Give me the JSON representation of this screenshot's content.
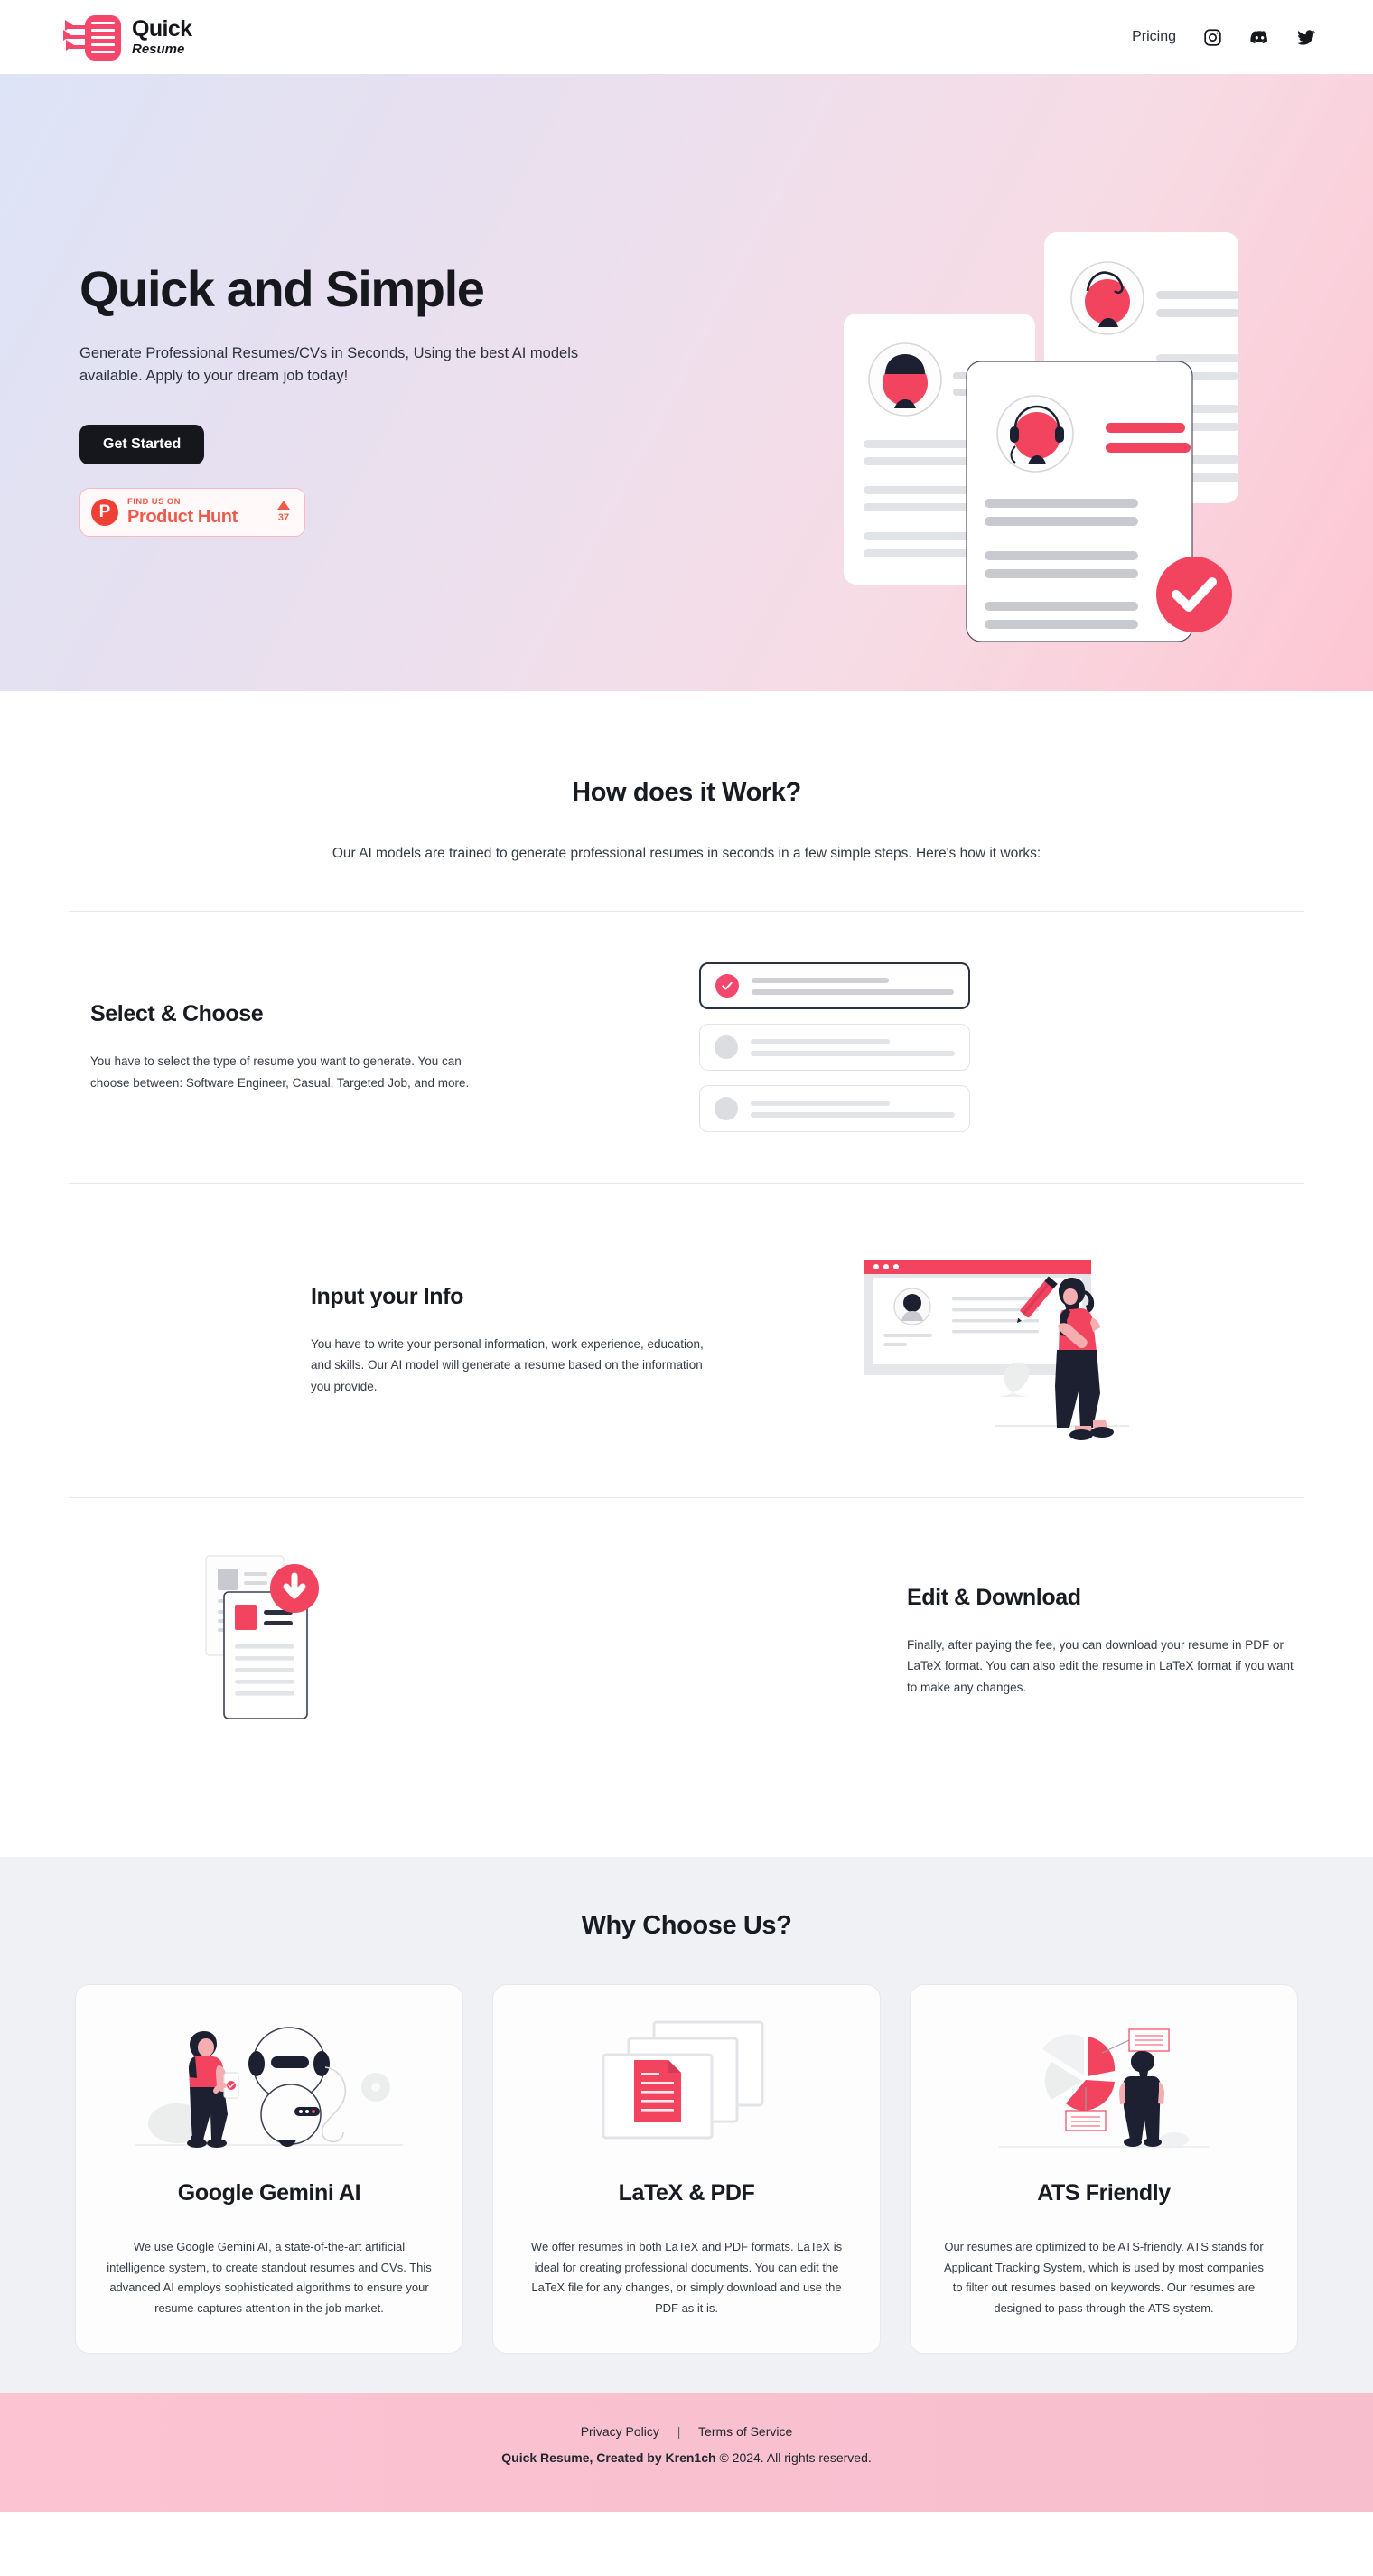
{
  "brand": {
    "name_line1": "Quick",
    "name_line2": "Resume",
    "logo_icon": "quick-resume-logo-icon"
  },
  "nav": {
    "pricing_label": "Pricing",
    "social": [
      {
        "name": "instagram-icon"
      },
      {
        "name": "discord-icon"
      },
      {
        "name": "twitter-icon"
      }
    ]
  },
  "hero": {
    "title": "Quick and Simple",
    "subtitle": "Generate Professional Resumes/CVs in Seconds, Using the best AI models available. Apply to your dream job today!",
    "cta_label": "Get Started",
    "product_hunt": {
      "small_label": "FIND US ON",
      "big_label": "Product Hunt",
      "upvotes": "37",
      "logo_letter": "P"
    }
  },
  "how_it_works": {
    "title": "How does it Work?",
    "subtitle": "Our AI models are trained to generate professional resumes in seconds in a few simple steps. Here's how it works:",
    "steps": [
      {
        "heading": "Select & Choose",
        "body": "You have to select the type of resume you want to generate. You can choose between: Software Engineer, Casual, Targeted Job, and more."
      },
      {
        "heading": "Input your Info",
        "body": "You have to write your personal information, work experience, education, and skills. Our AI model will generate a resume based on the information you provide."
      },
      {
        "heading": "Edit & Download",
        "body": "Finally, after paying the fee, you can download your resume in PDF or LaTeX format. You can also edit the resume in LaTeX format if you want to make any changes."
      }
    ]
  },
  "why_choose_us": {
    "title": "Why Choose Us?",
    "cards": [
      {
        "heading": "Google Gemini AI",
        "body": "We use Google Gemini AI, a state-of-the-art artificial intelligence system, to create standout resumes and CVs. This advanced AI employs sophisticated algorithms to ensure your resume captures attention in the job market."
      },
      {
        "heading": "LaTeX & PDF",
        "body": "We offer resumes in both LaTeX and PDF formats. LaTeX is ideal for creating professional documents. You can edit the LaTeX file for any changes, or simply download and use the PDF as it is."
      },
      {
        "heading": "ATS Friendly",
        "body": "Our resumes are optimized to be ATS-friendly. ATS stands for Applicant Tracking System, which is used by most companies to filter out resumes based on keywords. Our resumes are designed to pass through the ATS system."
      }
    ]
  },
  "footer": {
    "privacy_label": "Privacy Policy",
    "separator": "|",
    "terms_label": "Terms of Service",
    "copyright_bold": "Quick Resume, Created by Kren1ch",
    "copyright_rest": " © 2024. All rights reserved."
  },
  "colors": {
    "accent_pink": "#f5466b",
    "dark": "#15171c",
    "product_hunt_red": "#ef5a4b",
    "gray_section": "#f0f1f5"
  }
}
